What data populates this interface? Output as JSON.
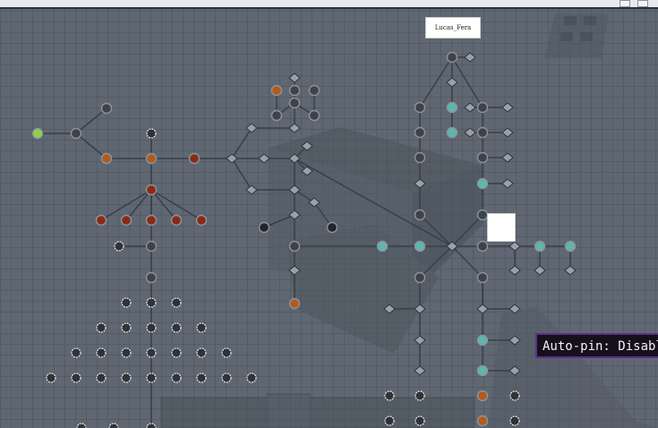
{
  "tooltip": {
    "text": "Auto-pin: Disabled"
  },
  "notes": [
    {
      "text": "Lucas_Fera"
    },
    {
      "text": ""
    }
  ],
  "colors": {
    "node_fill": "#3e4249",
    "node_ring": "#8d939c",
    "link": "#3a3f47",
    "accent_orange": "#b35a1f",
    "accent_red": "#8a2a16",
    "accent_teal": "#5fb5b0",
    "accent_green": "#8fd24a",
    "accent_white": "#e9ecef"
  }
}
